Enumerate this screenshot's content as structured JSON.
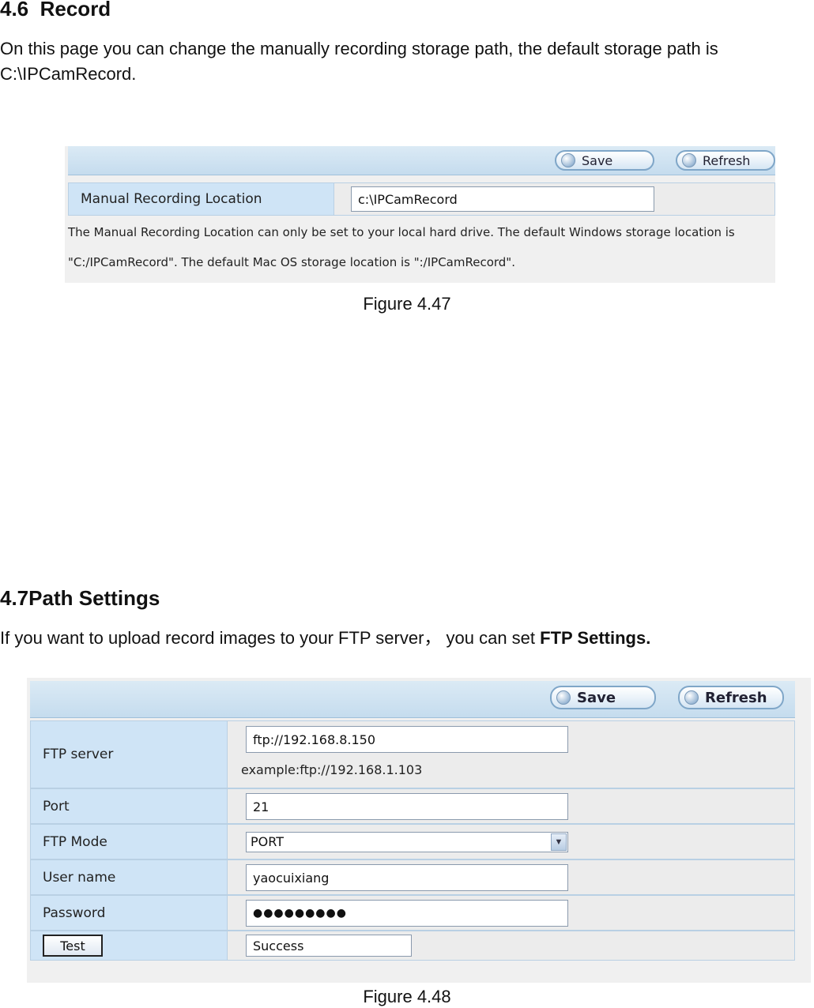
{
  "section_record": {
    "number": "4.6",
    "title": "Record",
    "body": "On this page you can change the manually recording storage path, the default storage path is C:\\IPCamRecord."
  },
  "figure_47": {
    "save_label": "Save",
    "refresh_label": "Refresh",
    "field_label": "Manual Recording Location",
    "field_value": "c:\\IPCamRecord",
    "note_line1": "The Manual Recording Location can only be set to your local hard drive. The default Windows storage location is",
    "note_line2": "\"C:/IPCamRecord\". The default Mac OS storage location is \":/IPCamRecord\".",
    "caption": "Figure 4.47"
  },
  "section_path": {
    "number": "4.7",
    "title": "Path Settings",
    "body_prefix": "If you want to upload record images to your FTP server， you can set ",
    "body_bold": "FTP Settings."
  },
  "figure_48": {
    "save_label": "Save",
    "refresh_label": "Refresh",
    "ftp_server_label": "FTP server",
    "ftp_server_value": "ftp://192.168.8.150",
    "ftp_server_example": "example:ftp://192.168.1.103",
    "port_label": "Port",
    "port_value": "21",
    "ftp_mode_label": "FTP Mode",
    "ftp_mode_value": "PORT",
    "user_name_label": "User name",
    "user_name_value": "yaocuixiang",
    "password_label": "Password",
    "password_value": "●●●●●●●●●",
    "test_label": "Test",
    "test_result": "Success",
    "caption": "Figure 4.48"
  }
}
